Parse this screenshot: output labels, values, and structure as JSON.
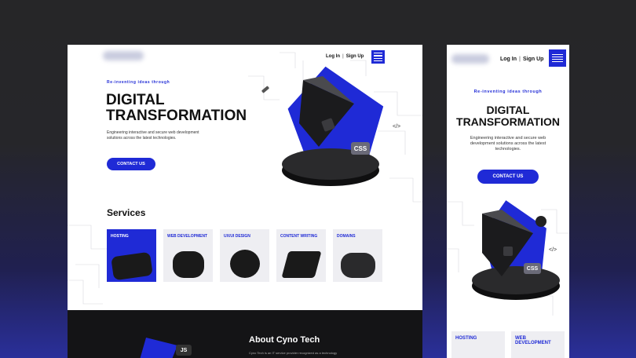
{
  "desktop": {
    "nav": {
      "login": "Log In",
      "signup": "Sign Up"
    },
    "hero": {
      "tagline": "Re-inventing ideas through",
      "title_line1": "DIGITAL",
      "title_line2": "TRANSFORMATION",
      "subtitle": "Engineering interactive and secure web development solutions across the latest technologies.",
      "cta": "CONTACT US",
      "badge_css": "CSS",
      "badge_code": "</>"
    },
    "services": {
      "title": "Services",
      "cards": [
        {
          "label": "HOSTING"
        },
        {
          "label": "WEB DEVELOPMENT"
        },
        {
          "label": "UX/UI DESIGN"
        },
        {
          "label": "CONTENT WRITING"
        },
        {
          "label": "DOMAINS"
        }
      ]
    },
    "about": {
      "title": "About Cyno Tech",
      "text": "Cyno Tech is an IT service provider recognized as a technology",
      "badge_js": "JS"
    }
  },
  "mobile": {
    "nav": {
      "login": "Log In",
      "signup": "Sign Up"
    },
    "hero": {
      "tagline": "Re-inventing ideas through",
      "title_line1": "DIGITAL",
      "title_line2": "TRANSFORMATION",
      "subtitle": "Engineering interactive and secure web development solutions across the latest technologies.",
      "cta": "CONTACT US",
      "badge_css": "CSS",
      "badge_code": "</>"
    },
    "services": {
      "cards": [
        {
          "label": "HOSTING"
        },
        {
          "label": "WEB DEVELOPMENT"
        }
      ]
    }
  },
  "colors": {
    "accent": "#1f2ad6",
    "dark": "#141416"
  }
}
